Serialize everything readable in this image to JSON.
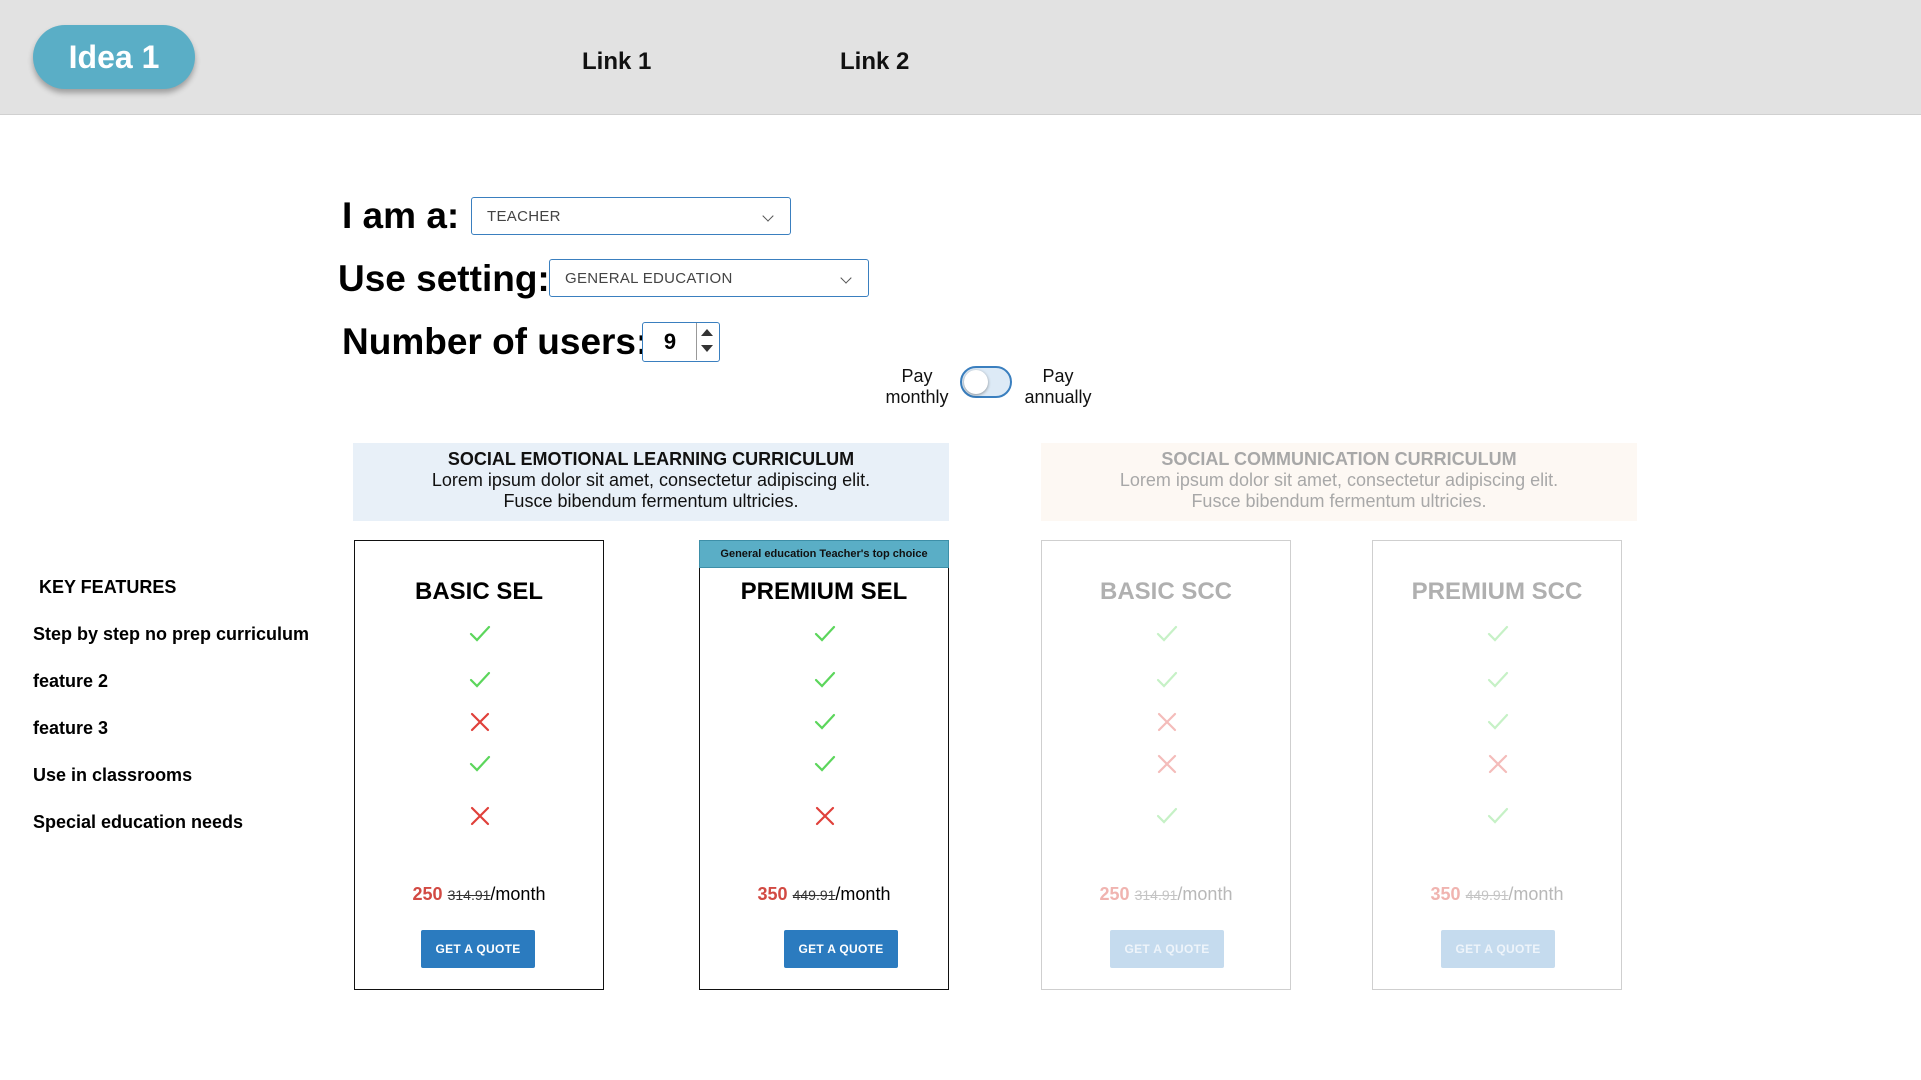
{
  "header": {
    "logo": "Idea 1",
    "links": [
      "Link 1",
      "Link 2"
    ]
  },
  "form": {
    "role_label": "I am a:",
    "role_value": "TEACHER",
    "setting_label": "Use setting:",
    "setting_value": "GENERAL EDUCATION",
    "users_label": "Number of users:",
    "users_value": "9"
  },
  "billing": {
    "monthly_line1": "Pay",
    "monthly_line2": "monthly",
    "annual_line1": "Pay",
    "annual_line2": "annually",
    "annual_selected": false
  },
  "curricula": [
    {
      "title": "SOCIAL EMOTIONAL LEARNING CURRICULUM",
      "desc_line1": "Lorem ipsum dolor sit amet, consectetur adipiscing elit.",
      "desc_line2": "Fusce bibendum fermentum ultricies."
    },
    {
      "title": "SOCIAL COMMUNICATION CURRICULUM",
      "desc_line1": "Lorem ipsum dolor sit amet, consectetur adipiscing elit.",
      "desc_line2": "Fusce bibendum fermentum ultricies."
    }
  ],
  "features": {
    "heading": "KEY FEATURES",
    "items": [
      "Step by step no prep curriculum",
      "feature 2",
      "feature 3",
      "Use in classrooms",
      "Special education needs"
    ]
  },
  "plans": [
    {
      "name": "BASIC SEL",
      "price": "250",
      "old_price": "314.91",
      "period": "/month",
      "button": "GET A QUOTE",
      "features": [
        true,
        true,
        false,
        true,
        false
      ]
    },
    {
      "name": "PREMIUM SEL",
      "badge": "General education Teacher's top choice",
      "price": "350",
      "old_price": "449.91",
      "period": "/month",
      "button": "GET A QUOTE",
      "features": [
        true,
        true,
        true,
        true,
        false
      ]
    },
    {
      "name": "BASIC SCC",
      "price": "250",
      "old_price": "314.91",
      "period": "/month",
      "button": "GET A QUOTE",
      "features": [
        true,
        true,
        false,
        false,
        true
      ]
    },
    {
      "name": "PREMIUM SCC",
      "price": "350",
      "old_price": "449.91",
      "period": "/month",
      "button": "GET A QUOTE",
      "features": [
        true,
        true,
        true,
        false,
        true
      ]
    }
  ],
  "colors": {
    "check": "#5cd65c",
    "cross": "#e0403a",
    "accent": "#2b7bbf",
    "logo": "#5aaec6"
  }
}
